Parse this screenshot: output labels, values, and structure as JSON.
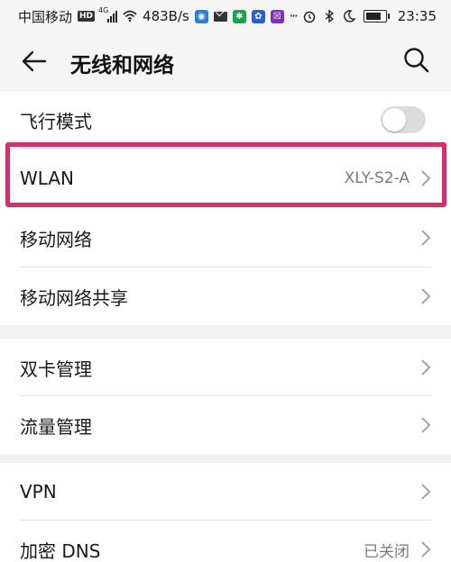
{
  "status_bar": {
    "carrier": "中国移动",
    "hd_badge": "HD",
    "net_type": "4G",
    "speed": "483B/s",
    "extra": "···",
    "time": "23:35"
  },
  "header": {
    "title": "无线和网络"
  },
  "group1": {
    "airplane_mode": {
      "label": "飞行模式",
      "enabled": false
    },
    "wlan": {
      "label": "WLAN",
      "value": "XLY-S2-A"
    },
    "mobile_network": {
      "label": "移动网络"
    },
    "tethering": {
      "label": "移动网络共享"
    }
  },
  "group2": {
    "dual_sim": {
      "label": "双卡管理"
    },
    "data_usage": {
      "label": "流量管理"
    }
  },
  "group3": {
    "vpn": {
      "label": "VPN"
    },
    "private_dns": {
      "label": "加密 DNS",
      "value": "已关闭"
    }
  },
  "colors": {
    "highlight": "#d3306c",
    "toggle_off": "#dcdcdc"
  }
}
